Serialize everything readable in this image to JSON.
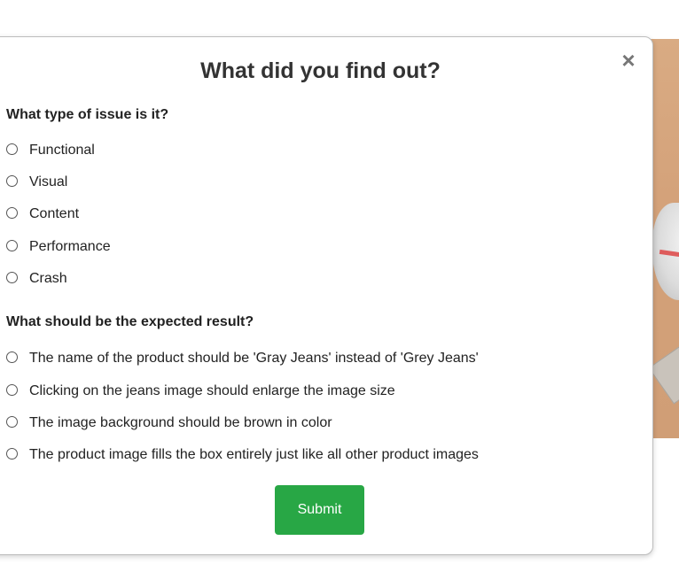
{
  "modal": {
    "title": "What did you find out?",
    "close_icon": "×"
  },
  "issue_type": {
    "question": "What type of issue is it?",
    "options": [
      "Functional",
      "Visual",
      "Content",
      "Performance",
      "Crash"
    ]
  },
  "expected_result": {
    "question": "What should be the expected result?",
    "options": [
      "The name of the product should be 'Gray Jeans' instead of 'Grey Jeans'",
      "Clicking on the jeans image should enlarge the image size",
      "The image background should be brown in color",
      "The product image fills the box entirely just like all other product images"
    ]
  },
  "submit": {
    "label": "Submit",
    "color": "#28a745"
  }
}
